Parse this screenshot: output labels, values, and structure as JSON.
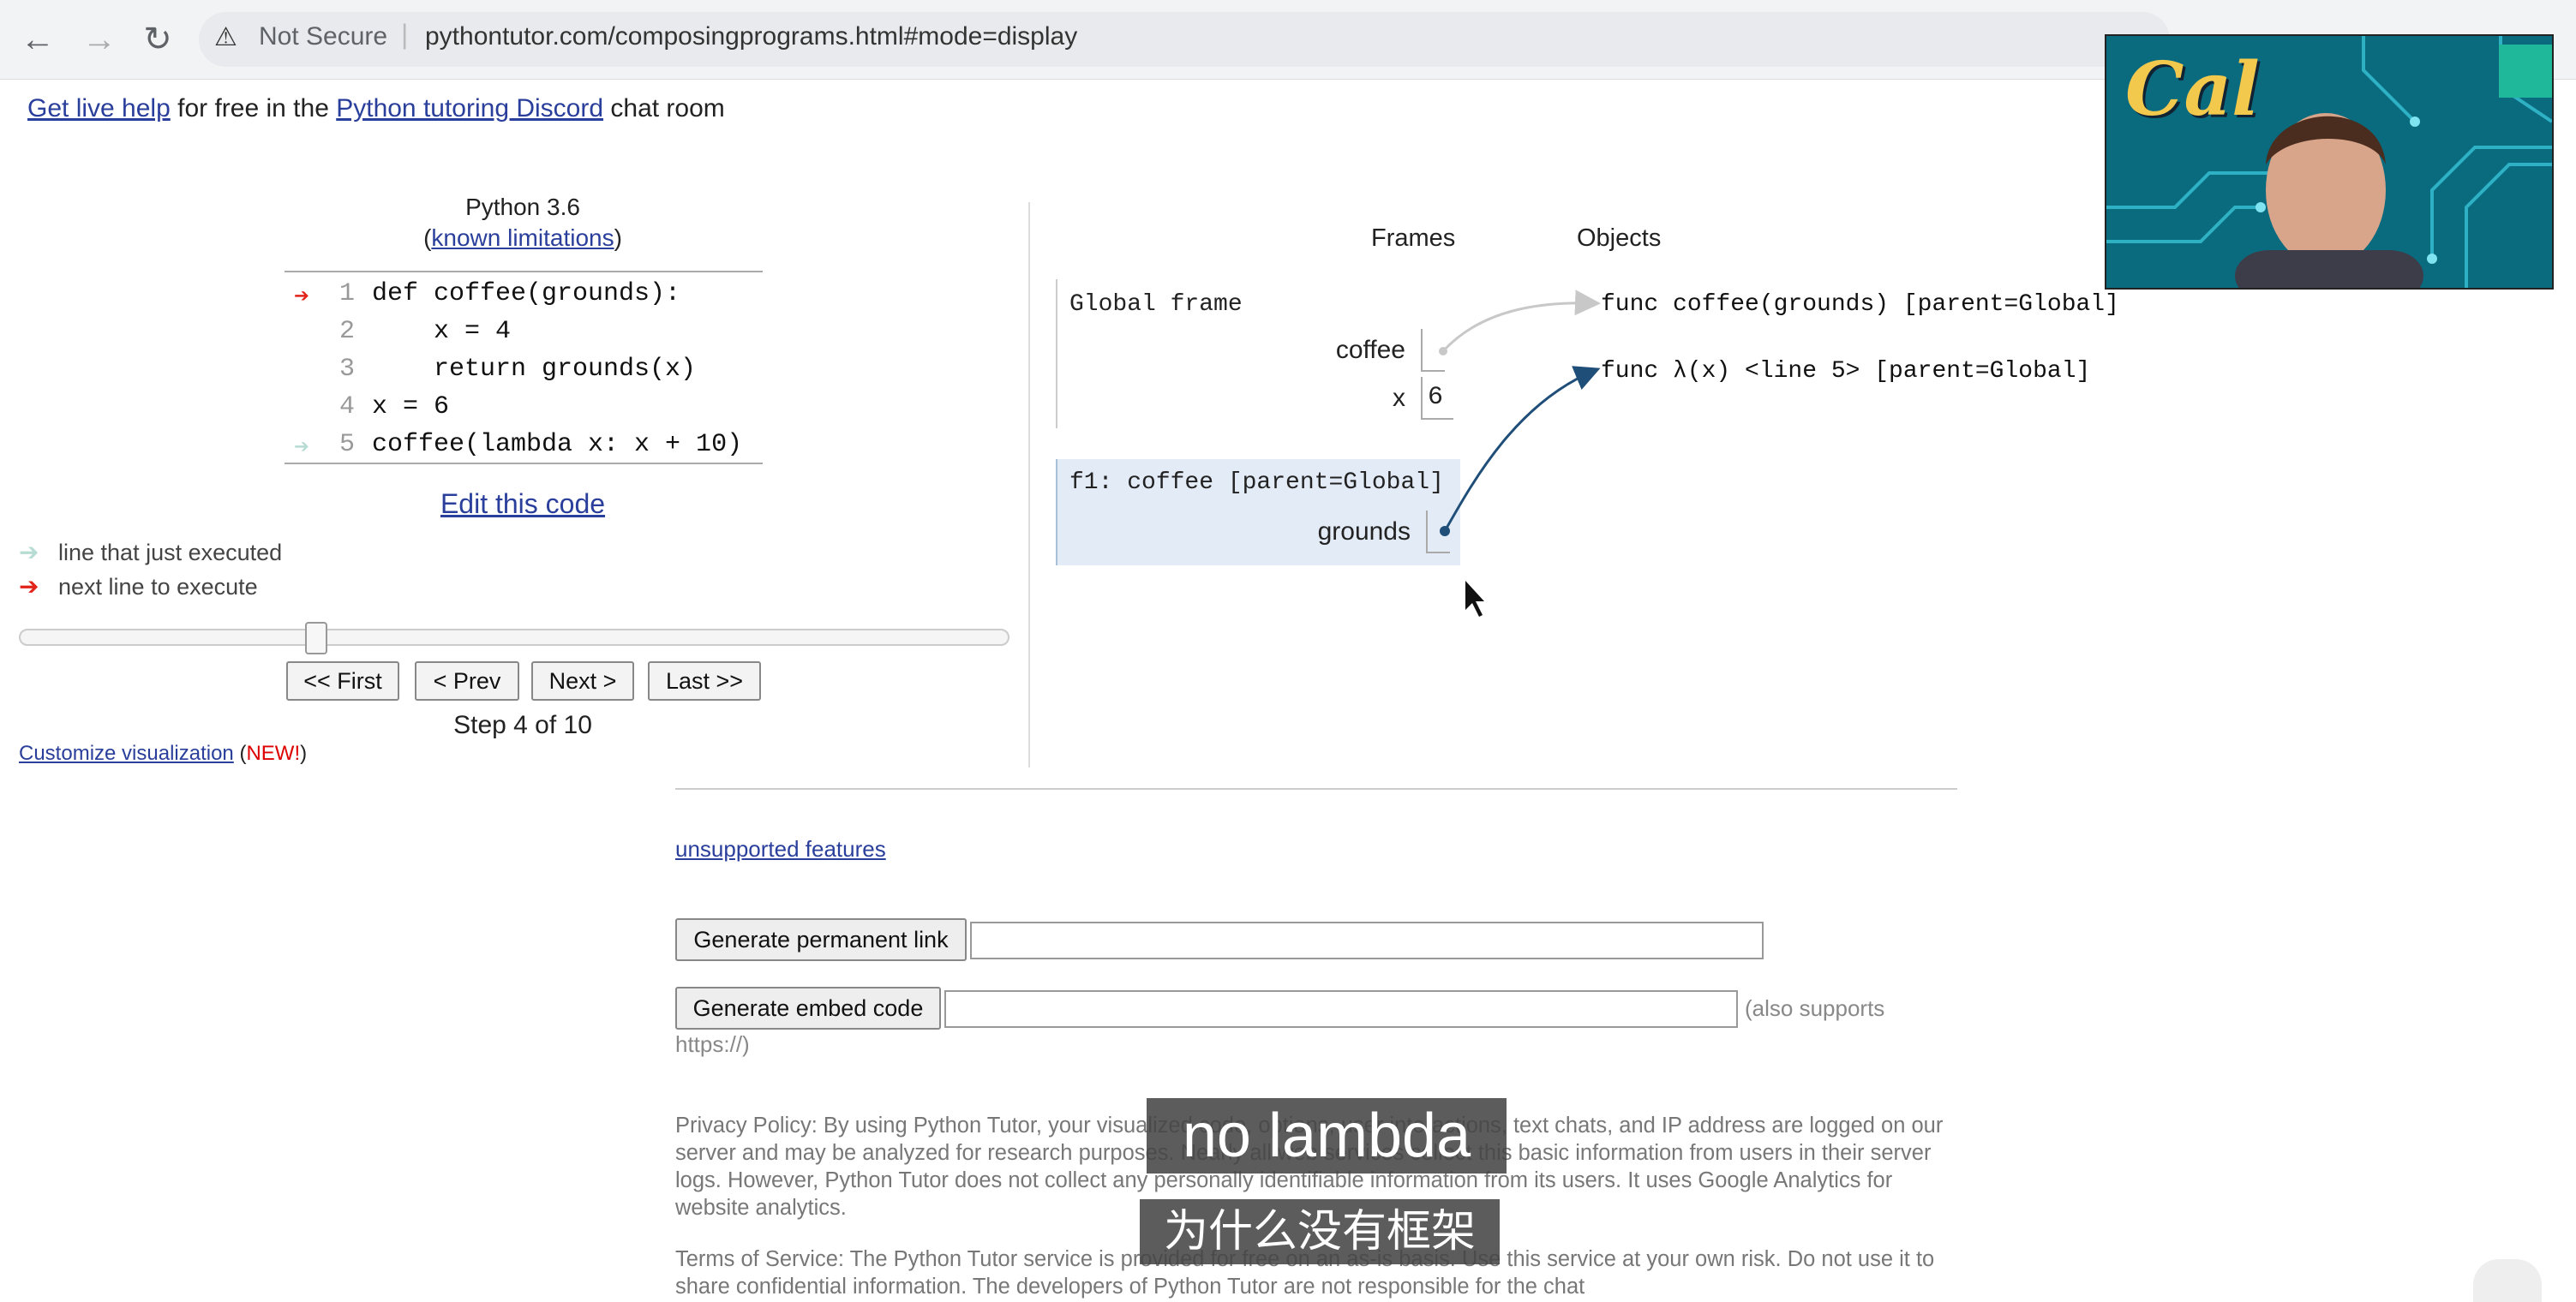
{
  "browser": {
    "security_label": "Not Secure",
    "url": "pythontutor.com/composingprograms.html#mode=display",
    "back_icon": "arrow-left-icon",
    "forward_icon": "arrow-right-icon",
    "reload_icon": "reload-icon"
  },
  "banner": {
    "live_help": "Get live help",
    "for_free": "for free in the",
    "discord": "Python tutoring Discord",
    "chat_room": "chat room"
  },
  "editor": {
    "language": "Python 3.6",
    "limits_open": "(",
    "limits_link": "known limitations",
    "limits_close": ")",
    "lines": [
      {
        "num": "1",
        "code": "def coffee(grounds):",
        "marker": "red"
      },
      {
        "num": "2",
        "code": "    x = 4",
        "marker": ""
      },
      {
        "num": "3",
        "code": "    return grounds(x)",
        "marker": ""
      },
      {
        "num": "4",
        "code": "x = 6",
        "marker": ""
      },
      {
        "num": "5",
        "code": "coffee(lambda x: x + 10)",
        "marker": "green"
      }
    ],
    "edit_code": "Edit this code"
  },
  "legend": {
    "executed": "line that just executed",
    "next": "next line to execute"
  },
  "navigation": {
    "first": "<< First",
    "prev": "< Prev",
    "next": "Next >",
    "last": "Last >>",
    "step": "Step 4 of 10",
    "step_current": 4,
    "step_total": 10
  },
  "customize": {
    "link": "Customize visualization",
    "open": "(",
    "new": "NEW!",
    "close": ")"
  },
  "viz": {
    "frames_heading": "Frames",
    "objects_heading": "Objects",
    "global_frame": {
      "title": "Global frame",
      "vars": [
        {
          "name": "coffee",
          "value": ""
        },
        {
          "name": "x",
          "value": "6"
        }
      ]
    },
    "f1_frame": {
      "title": "f1: coffee [parent=Global]",
      "vars": [
        {
          "name": "grounds",
          "value": ""
        }
      ]
    },
    "objects": [
      "func coffee(grounds) [parent=Global]",
      "func λ(x) <line 5> [parent=Global]"
    ]
  },
  "webcam": {
    "logo_text": "Cal"
  },
  "footer": {
    "unsupported": "unsupported features",
    "perm_link_button": "Generate permanent link",
    "embed_button": "Generate embed code",
    "also_supports": "(also supports",
    "https": "https://)",
    "privacy": "Privacy Policy: By using Python Tutor, your visualized code, options, user interactions, text chats, and IP address are logged on our server and may be analyzed for research purposes. Nearly all web services collect this basic information from users in their server logs. However, Python Tutor does not collect any personally identifiable information from its users. It uses Google Analytics for website analytics.",
    "terms": "Terms of Service: The Python Tutor service is provided for free on an as-is basis. Use this service at your own risk. Do not use it to share confidential information. The developers of Python Tutor are not responsible for the chat"
  },
  "subtitles": {
    "english": "no lambda",
    "chinese": "为什么没有框架"
  }
}
